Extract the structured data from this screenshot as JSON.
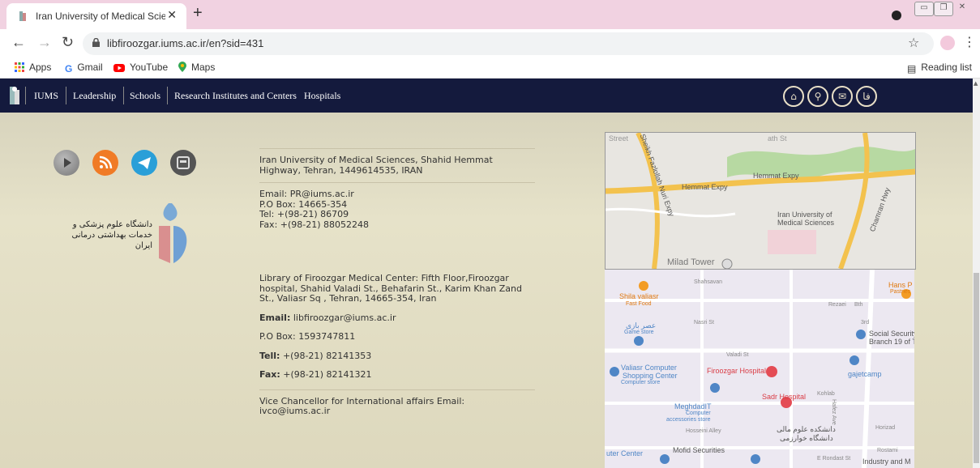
{
  "browser": {
    "tab_title": "Iran University of Medical Science",
    "url": "libfiroozgar.iums.ac.ir/en?sid=431",
    "bookmarks": [
      "Apps",
      "Gmail",
      "YouTube",
      "Maps"
    ],
    "reading_list": "Reading list"
  },
  "site_nav": {
    "items": [
      "IUMS",
      "Leadership",
      "Schools",
      "Research Institutes and Centers",
      "Hospitals"
    ],
    "icons": [
      "home-icon",
      "search-icon",
      "mail-icon",
      "persian-language-icon"
    ],
    "lang_label": "فا",
    "accent": "#141a3d"
  },
  "footer": {
    "address1": "Iran University of Medical Sciences, Shahid Hemmat Highway, Tehran, 1449614535, IRAN",
    "contact1": [
      "Email: PR@iums.ac.ir",
      "P.O Box: 14665-354",
      "Tel: +(98-21) 86709",
      "Fax: +(98-21) 88052248"
    ],
    "address2": "Library of Firoozgar Medical Center: Fifth Floor,Firoozgar hospital, Shahid Valadi St., Behafarin St., Karim Khan Zand St., Valiasr Sq , Tehran, 14665-354, Iran",
    "contact2": {
      "email_label": "Email:",
      "email": "libfiroozgar@iums.ac.ir",
      "pobox": "P.O Box: 1593747811",
      "tell_label": "Tell:",
      "tell": "+(98-21) 82141353",
      "fax_label": "Fax:",
      "fax": "+(98-21) 82141321"
    },
    "vice": "Vice Chancellor for International affairs Email: ivco@iums.ac.ir",
    "logo_text": "دانشگاه علوم پزشکی و خدمات بهداشتی درمانی ایران",
    "social_icons": [
      "video-icon",
      "rss-icon",
      "telegram-icon",
      "news-icon"
    ]
  },
  "map1": {
    "labels": [
      "Hemmat Expy",
      "Hemmat Expy",
      "Sheikh Fazlollah Nuri Expy",
      "Iran University of Medical Sciences",
      "Milad Tower",
      "Chamran Hwy",
      "Street",
      "ath St"
    ]
  },
  "map2": {
    "labels": [
      "Shila valiasr",
      "Fast Food",
      "Shahsavan",
      "عصر بازی",
      "Game store",
      "Nasri St",
      "Valadi St",
      "Valiasr Computer",
      "Shopping Center",
      "Computer store",
      "Firoozgar Hospital",
      "Sadr Hospital",
      "MeghdadIT",
      "Computer",
      "accessories store",
      "Hosseini Alley",
      "دانشکده علوم مالی",
      "دانشگاه خوارزمی",
      "Mofid Securities",
      "uter Center",
      "Social Security",
      "Branch 19 of T",
      "gajetcamp",
      "Hans P",
      "Pastries",
      "Industry and M",
      "Rezaei",
      "Horizad",
      "Kohlab",
      "E Rondast St",
      "Rostami",
      "Bth",
      "Hafez Ave",
      "3rd"
    ]
  }
}
